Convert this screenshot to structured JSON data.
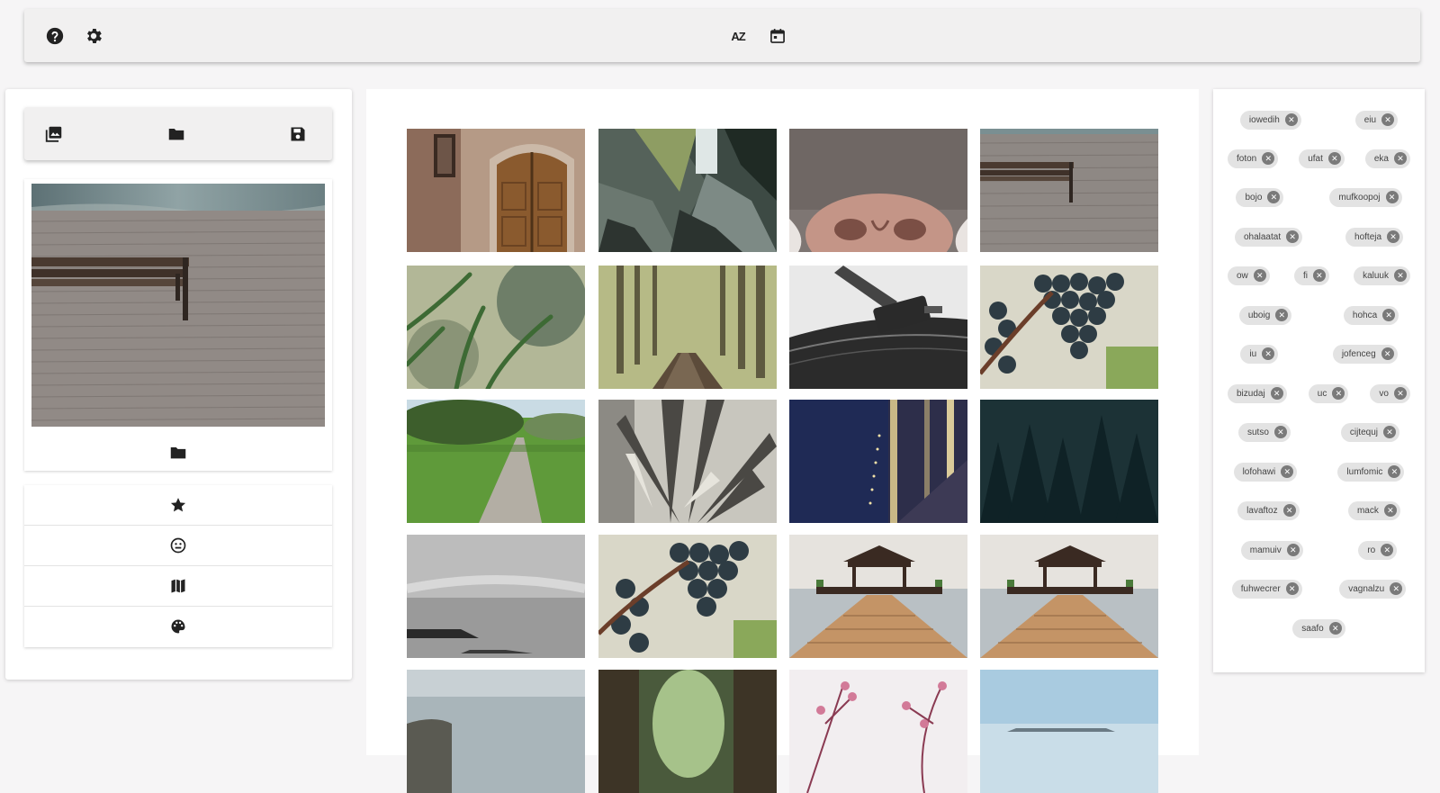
{
  "toolbar": {
    "help_icon": "help-circle-icon",
    "settings_icon": "gear-icon",
    "sort_alpha_label": "AZ",
    "sort_date_icon": "calendar-icon"
  },
  "left_toolbar": {
    "icons": [
      "image-album-icon",
      "folder-icon",
      "save-icon"
    ]
  },
  "preview": {
    "folder_icon": "folder-icon"
  },
  "metadata_actions": [
    {
      "icon": "star-icon"
    },
    {
      "icon": "face-icon"
    },
    {
      "icon": "map-icon"
    },
    {
      "icon": "palette-icon"
    }
  ],
  "gallery": {
    "rows_visible": 5,
    "columns": 4,
    "thumbnails": [
      "old-wooden-door",
      "waterfall-rocks",
      "cat-nose",
      "bench-boardwalk",
      "grass-blades",
      "forest-path",
      "turntable-needle",
      "grapes-vine",
      "park-path",
      "agave-plant",
      "night-bridge",
      "dark-forest",
      "foggy-shore",
      "grapes-vine",
      "pier-gazebo",
      "pier-gazebo",
      "sea-horizon",
      "forest-archway",
      "pink-blossoms",
      "blue-sky-water"
    ]
  },
  "tags": {
    "items": [
      "iowedih",
      "eiu",
      "foton",
      "ufat",
      "eka",
      "bojo",
      "mufkoopoj",
      "ohalaatat",
      "hofteja",
      "ow",
      "fi",
      "kaluuk",
      "uboig",
      "hohca",
      "iu",
      "jofenceg",
      "bizudaj",
      "uc",
      "vo",
      "sutso",
      "cijtequj",
      "lofohawi",
      "lumfomic",
      "lavaftoz",
      "mack",
      "mamuiv",
      "ro",
      "fuhwecrer",
      "vagnalzu",
      "saafo"
    ]
  }
}
